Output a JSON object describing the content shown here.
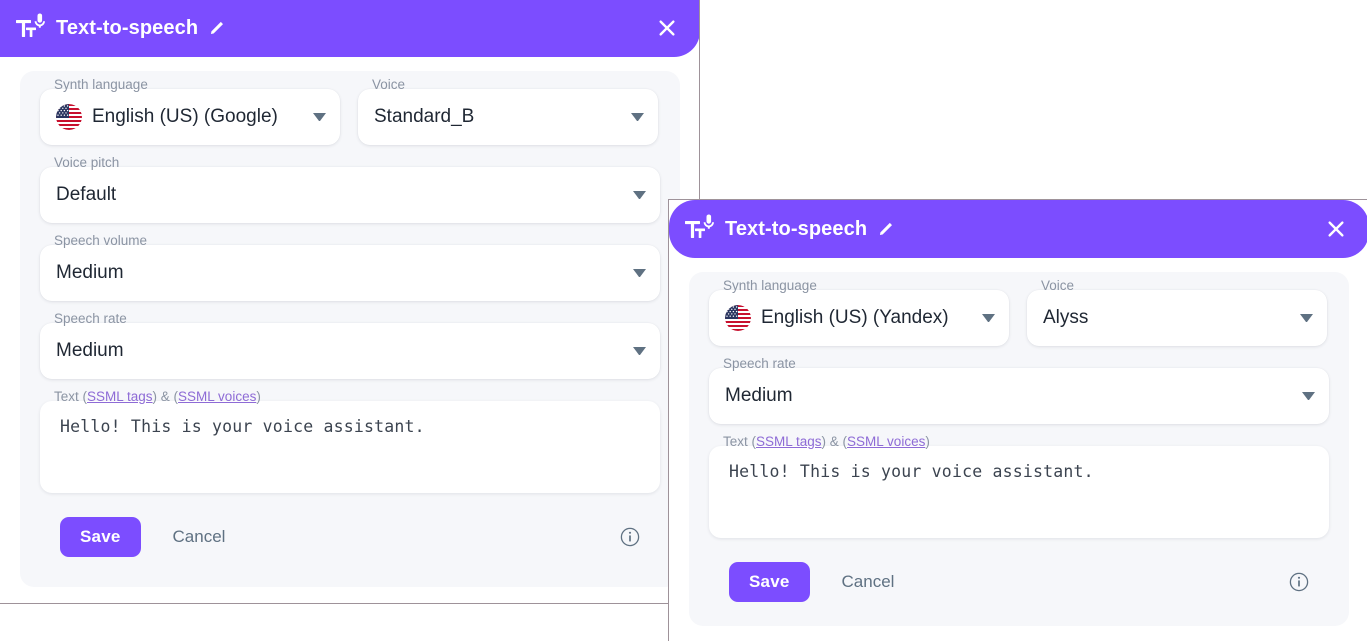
{
  "theme": {
    "accent": "#7c4dff",
    "panel_bg": "#f6f7fa",
    "field_bg": "#ffffff",
    "label_color": "#8b94a3",
    "value_color": "#1f2733",
    "link_color": "#8e6bd6",
    "border_color": "#9e9299"
  },
  "dialogs": [
    {
      "title": "Text-to-speech",
      "icon": "text-to-speech-icon",
      "edit_icon": "pencil-icon",
      "close_icon": "close-icon",
      "fields": [
        {
          "label": "Synth language",
          "value": "English (US) (Google)",
          "icon": "us-flag-icon",
          "control": "select"
        },
        {
          "label": "Voice",
          "value": "Standard_B",
          "control": "select"
        },
        {
          "label": "Voice pitch",
          "value": "Default",
          "control": "select"
        },
        {
          "label": "Speech volume",
          "value": "Medium",
          "control": "select"
        },
        {
          "label": "Speech rate",
          "value": "Medium",
          "control": "select"
        }
      ],
      "text_field": {
        "label_prefix": "Text (",
        "link1": "SSML tags",
        "label_middle": ") & (",
        "link2": "SSML voices",
        "label_suffix": ")",
        "value": "Hello! This is your voice assistant."
      },
      "actions": {
        "save_label": "Save",
        "cancel_label": "Cancel",
        "info_icon": "info-icon"
      }
    },
    {
      "title": "Text-to-speech",
      "icon": "text-to-speech-icon",
      "edit_icon": "pencil-icon",
      "close_icon": "close-icon",
      "fields": [
        {
          "label": "Synth language",
          "value": "English (US) (Yandex)",
          "icon": "us-flag-icon",
          "control": "select"
        },
        {
          "label": "Voice",
          "value": "Alyss",
          "control": "select"
        },
        {
          "label": "Speech rate",
          "value": "Medium",
          "control": "select"
        }
      ],
      "text_field": {
        "label_prefix": "Text (",
        "link1": "SSML tags",
        "label_middle": ") & (",
        "link2": "SSML voices",
        "label_suffix": ")",
        "value": "Hello! This is your voice assistant."
      },
      "actions": {
        "save_label": "Save",
        "cancel_label": "Cancel",
        "info_icon": "info-icon"
      }
    }
  ]
}
